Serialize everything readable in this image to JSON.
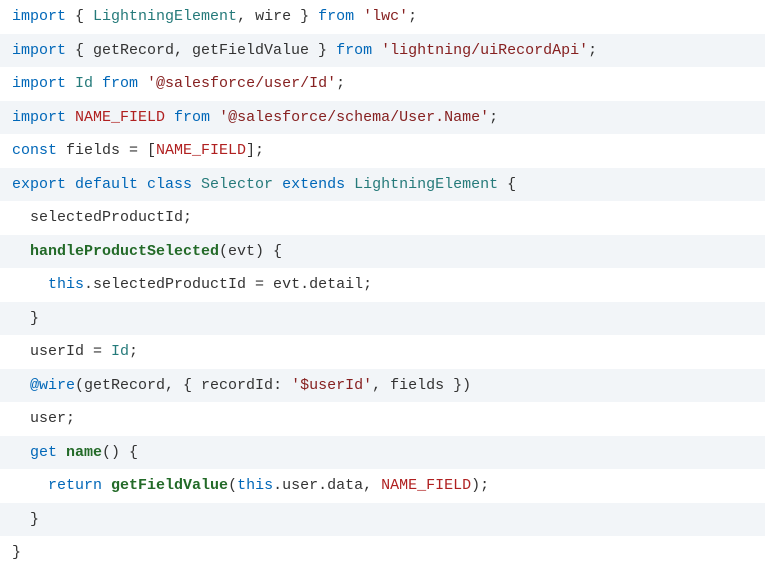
{
  "code": {
    "lines": [
      {
        "indent": 0,
        "tokens": [
          {
            "t": "import ",
            "c": "kw"
          },
          {
            "t": "{ ",
            "c": ""
          },
          {
            "t": "LightningElement",
            "c": "cls"
          },
          {
            "t": ", wire } ",
            "c": ""
          },
          {
            "t": "from ",
            "c": "kw"
          },
          {
            "t": "'lwc'",
            "c": "str"
          },
          {
            "t": ";",
            "c": ""
          }
        ]
      },
      {
        "indent": 0,
        "tokens": [
          {
            "t": "import ",
            "c": "kw"
          },
          {
            "t": "{ getRecord, getFieldValue } ",
            "c": ""
          },
          {
            "t": "from ",
            "c": "kw"
          },
          {
            "t": "'lightning/uiRecordApi'",
            "c": "str"
          },
          {
            "t": ";",
            "c": ""
          }
        ]
      },
      {
        "indent": 0,
        "tokens": [
          {
            "t": "import ",
            "c": "kw"
          },
          {
            "t": "Id ",
            "c": "cls"
          },
          {
            "t": "from ",
            "c": "kw"
          },
          {
            "t": "'@salesforce/user/Id'",
            "c": "str"
          },
          {
            "t": ";",
            "c": ""
          }
        ]
      },
      {
        "indent": 0,
        "tokens": [
          {
            "t": "import ",
            "c": "kw"
          },
          {
            "t": "NAME_FIELD ",
            "c": "upper"
          },
          {
            "t": "from ",
            "c": "kw"
          },
          {
            "t": "'@salesforce/schema/User.Name'",
            "c": "str"
          },
          {
            "t": ";",
            "c": ""
          }
        ]
      },
      {
        "indent": 0,
        "tokens": [
          {
            "t": "const ",
            "c": "kw"
          },
          {
            "t": "fields = [",
            "c": ""
          },
          {
            "t": "NAME_FIELD",
            "c": "upper"
          },
          {
            "t": "];",
            "c": ""
          }
        ]
      },
      {
        "indent": 0,
        "tokens": [
          {
            "t": "export ",
            "c": "kw"
          },
          {
            "t": "default ",
            "c": "kw"
          },
          {
            "t": "class ",
            "c": "kw"
          },
          {
            "t": "Selector ",
            "c": "cls"
          },
          {
            "t": "extends ",
            "c": "kw"
          },
          {
            "t": "LightningElement ",
            "c": "cls"
          },
          {
            "t": "{",
            "c": ""
          }
        ]
      },
      {
        "indent": 1,
        "tokens": [
          {
            "t": "selectedProductId;",
            "c": ""
          }
        ]
      },
      {
        "indent": 1,
        "tokens": [
          {
            "t": "handleProductSelected",
            "c": "fn"
          },
          {
            "t": "(evt) {",
            "c": ""
          }
        ]
      },
      {
        "indent": 2,
        "tokens": [
          {
            "t": "this",
            "c": "kw"
          },
          {
            "t": ".selectedProductId = evt.detail;",
            "c": ""
          }
        ]
      },
      {
        "indent": 1,
        "tokens": [
          {
            "t": "}",
            "c": ""
          }
        ]
      },
      {
        "indent": 1,
        "tokens": [
          {
            "t": "userId = ",
            "c": ""
          },
          {
            "t": "Id",
            "c": "cls"
          },
          {
            "t": ";",
            "c": ""
          }
        ]
      },
      {
        "indent": 1,
        "tokens": [
          {
            "t": "@wire",
            "c": "kw"
          },
          {
            "t": "(getRecord, { recordId: ",
            "c": ""
          },
          {
            "t": "'$userId'",
            "c": "str"
          },
          {
            "t": ", fields })",
            "c": ""
          }
        ]
      },
      {
        "indent": 1,
        "tokens": [
          {
            "t": "user;",
            "c": ""
          }
        ]
      },
      {
        "indent": 1,
        "tokens": [
          {
            "t": "get ",
            "c": "kw"
          },
          {
            "t": "name",
            "c": "fn"
          },
          {
            "t": "() {",
            "c": ""
          }
        ]
      },
      {
        "indent": 2,
        "tokens": [
          {
            "t": "return ",
            "c": "kw"
          },
          {
            "t": "getFieldValue",
            "c": "fn"
          },
          {
            "t": "(",
            "c": ""
          },
          {
            "t": "this",
            "c": "kw"
          },
          {
            "t": ".user.data, ",
            "c": ""
          },
          {
            "t": "NAME_FIELD",
            "c": "upper"
          },
          {
            "t": ");",
            "c": ""
          }
        ]
      },
      {
        "indent": 1,
        "tokens": [
          {
            "t": "}",
            "c": ""
          }
        ]
      },
      {
        "indent": 0,
        "tokens": [
          {
            "t": "}",
            "c": ""
          }
        ]
      }
    ]
  }
}
